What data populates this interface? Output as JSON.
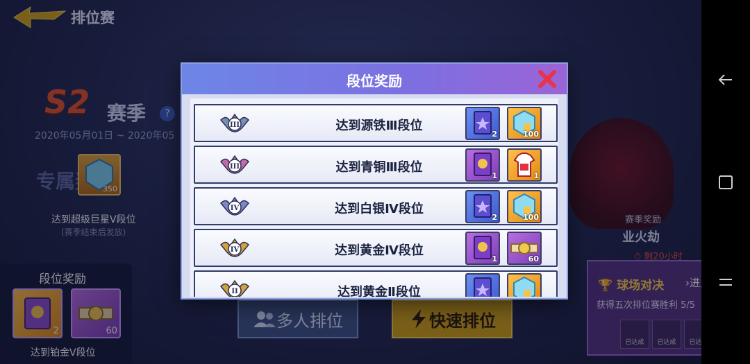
{
  "header": {
    "title": "排位赛"
  },
  "season": {
    "code": "S2",
    "word": "赛季",
    "help": "?",
    "dates": "2020年05月01日 ~ 2020年05"
  },
  "exclusive": {
    "label": "专属奖励",
    "item_count": "350",
    "target": "达到超级巨星Ⅴ段位",
    "note": "(赛季结束后发放)"
  },
  "left_panel": {
    "title": "段位奖励",
    "items": [
      {
        "count": "2"
      },
      {
        "count": "60"
      }
    ],
    "target": "达到铂金Ⅴ段位"
  },
  "buttons": {
    "multi": "多人排位",
    "quick": "快速排位"
  },
  "season_reward": {
    "label": "赛季奖励",
    "name": "业火劫",
    "timer": "剩20小时"
  },
  "quest": {
    "title": "球场对决",
    "enter": "进入",
    "desc": "获得五次排位赛胜利 5/5",
    "claimed_label": "已达成"
  },
  "modal": {
    "title": "段位奖励",
    "rows": [
      {
        "label": "达到源铁Ⅲ段位",
        "rank": "III",
        "rank_color": "#7a8fb6",
        "items": [
          {
            "count": "2",
            "kind": "blue-book"
          },
          {
            "count": "100",
            "kind": "gem"
          }
        ]
      },
      {
        "label": "达到青铜Ⅲ段位",
        "rank": "III",
        "rank_color": "#c26aa8",
        "items": [
          {
            "count": "1",
            "kind": "purple-book"
          },
          {
            "count": "1",
            "kind": "jersey"
          }
        ]
      },
      {
        "label": "达到白银Ⅳ段位",
        "rank": "IV",
        "rank_color": "#7c86c8",
        "items": [
          {
            "count": "2",
            "kind": "blue-book"
          },
          {
            "count": "100",
            "kind": "gem"
          }
        ]
      },
      {
        "label": "达到黄金Ⅳ段位",
        "rank": "IV",
        "rank_color": "#d4a23a",
        "items": [
          {
            "count": "1",
            "kind": "purple-book"
          },
          {
            "count": "60",
            "kind": "belt"
          }
        ]
      },
      {
        "label": "达到黄金Ⅱ段位",
        "rank": "II",
        "rank_color": "#d4a23a",
        "items": [
          {
            "count": "",
            "kind": "blue-book"
          },
          {
            "count": "",
            "kind": "gem"
          }
        ]
      }
    ]
  },
  "colors": {
    "accent": "#7d6fe1",
    "close": "#e8334a",
    "gold": "#d6a415"
  }
}
